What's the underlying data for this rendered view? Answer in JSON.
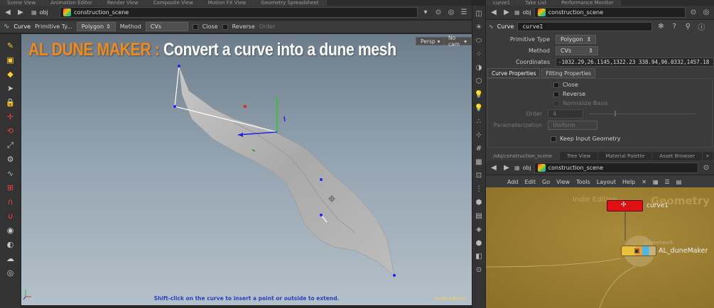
{
  "viewport_tabs": [
    "Scene View",
    "Animation Editor",
    "Render View",
    "Composite View",
    "Motion FX View",
    "Geometry Spreadsheet"
  ],
  "right_tabs": [
    "curve1",
    "Take List",
    "Performance Monitor"
  ],
  "left_path": {
    "context": "obj",
    "node": "construction_scene"
  },
  "right_path": {
    "context": "obj",
    "node": "construction_scene"
  },
  "op_toolbar": {
    "tool": "Curve",
    "primitive_type_label": "Primitive Ty...",
    "primitive_type_value": "Polygon",
    "method_label": "Method",
    "method_value": "CVs",
    "close_label": "Close",
    "reverse_label": "Reverse",
    "order_label": "Order"
  },
  "banner": {
    "prefix": "AL DUNE MAKER",
    "colon": " : ",
    "rest": "Convert a curve into a dune mesh",
    "prefix_color": "#f08a1e",
    "rest_color": "#ffffff"
  },
  "view_buttons": {
    "persp": "Persp",
    "cam": "No cam"
  },
  "status_hint": "Shift-click on the curve to insert a point or outside to extend.",
  "edition_label": "Indie Edition",
  "parm_panel": {
    "node_type": "Curve",
    "node_name": "curve1",
    "primitive_type_label": "Primitive Type",
    "primitive_type_value": "Polygon",
    "method_label": "Method",
    "method_value": "CVs",
    "coords_label": "Coordinates",
    "coords_value": "-1032.29,26.1145,1322.23 338.94,96.0332,1457.18 1",
    "tabs": [
      "Curve Properties",
      "Fitting Properties"
    ],
    "close_label": "Close",
    "reverse_label": "Reverse",
    "normalize_label": "Normalize Basis",
    "order_label": "Order",
    "order_value": "4",
    "param_label": "Parameterization",
    "param_value": "Uniform",
    "keep_label": "Keep Input Geometry"
  },
  "net_tabs": [
    "/obj/construction_scene",
    "Tree View",
    "Material Palette",
    "Asset Browser"
  ],
  "net_menu": [
    "Add",
    "Edit",
    "Go",
    "View",
    "Tools",
    "Layout",
    "Help"
  ],
  "network": {
    "watermark_left": "Indie Edition",
    "watermark_right": "Geometry",
    "node1": "curve1",
    "node2_type": "Subnetwork",
    "node2": "AL_duneMaker"
  },
  "colors": {
    "node_red": "#e01010",
    "net_bg": "#9a7d33",
    "viewport_bg": "#93a3b0"
  }
}
